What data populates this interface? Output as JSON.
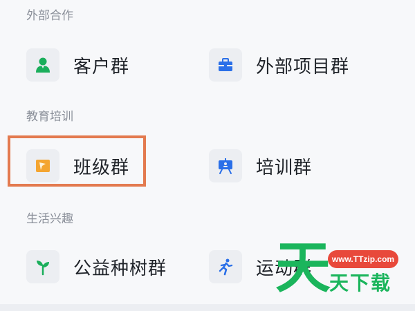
{
  "sections": [
    {
      "title": "外部合作",
      "items": [
        {
          "label": "客户群",
          "icon": "customer-person-icon"
        },
        {
          "label": "外部项目群",
          "icon": "briefcase-icon"
        }
      ]
    },
    {
      "title": "教育培训",
      "items": [
        {
          "label": "班级群",
          "icon": "class-book-icon"
        },
        {
          "label": "培训群",
          "icon": "presentation-board-icon"
        }
      ]
    },
    {
      "title": "生活兴趣",
      "items": [
        {
          "label": "公益种树群",
          "icon": "sprout-icon"
        },
        {
          "label": "运动群",
          "icon": "running-person-icon"
        }
      ]
    }
  ],
  "watermark": {
    "url": "www.TTzip.com",
    "big_char": "天",
    "small_text": "天下载"
  },
  "colors": {
    "green": "#1aae5b",
    "blue": "#2a6fe8",
    "orange": "#f4a531",
    "highlight": "#e37a4f"
  }
}
